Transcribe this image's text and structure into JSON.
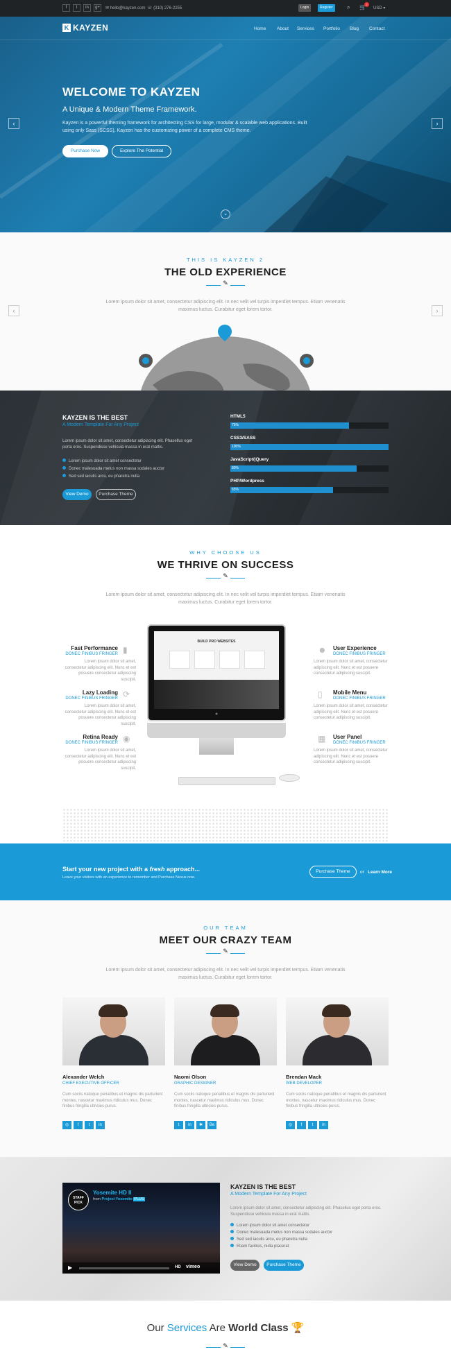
{
  "topbar": {
    "social_icons": [
      "facebook-icon",
      "twitter-icon",
      "linkedin-icon",
      "google-plus-icon"
    ],
    "social_glyphs": [
      "f",
      "t",
      "in",
      "g+"
    ],
    "email": "hello@kayzen.com",
    "phone": "(310) 276-2255",
    "login_label": "Login",
    "register_label": "Register",
    "currency": "USD",
    "cart_count": "2"
  },
  "header": {
    "logo_text": "KAYZEN",
    "nav": [
      "Home",
      "About",
      "Services",
      "Portfolio",
      "Blog",
      "Contact"
    ]
  },
  "hero": {
    "title": "WELCOME TO KAYZEN",
    "subtitle": "A Unique & Modern Theme Framework.",
    "body": "Kayzen is a powerful theming framework for architecting CSS for large, modular & scalable web applications. Built using only Sass (SCSS), Kayzen has the customizing power of a complete CMS theme.",
    "btn_primary": "Purchase Now",
    "btn_secondary": "Explore The Potential",
    "prev_glyph": "‹",
    "next_glyph": "›",
    "scroll_glyph": "⌄"
  },
  "old_experience": {
    "kicker": "THIS IS KAYZEN 2",
    "title": "THE OLD EXPERIENCE",
    "lead": "Lorem ipsum dolor sit amet, consectetur adipiscing elit. In nec velit vel turpis imperdiet tempus. Etiam venenatis maximus luctus. Curabitur eget lorem tortor."
  },
  "best": {
    "title": "KAYZEN IS THE BEST",
    "subtitle": "A Modern Template For Any Project",
    "body": "Lorem ipsum dolor sit amet, consectetur adipiscing elit. Phasellus eget porta eros. Suspendisse vehicula massa in erat mattis.",
    "list": [
      "Lorem ipsum dolor sit amet consectetur",
      "Donec malesuada metus non massa sodales auctor",
      "Sed sed iaculis arcu, eu pharetra nulla"
    ],
    "btn1": "View Demo",
    "btn2": "Purchase Theme",
    "skills": [
      {
        "label": "HTML5",
        "pct": "75%",
        "value": 0.75
      },
      {
        "label": "CSS3/SASS",
        "pct": "100%",
        "value": 1.0
      },
      {
        "label": "JavaScript/jQuery",
        "pct": "80%",
        "value": 0.8
      },
      {
        "label": "PHP/Wordpress",
        "pct": "65%",
        "value": 0.65
      }
    ]
  },
  "why": {
    "kicker": "WHY CHOOSE US",
    "title": "WE THRIVE ON SUCCESS",
    "lead": "Lorem ipsum dolor sit amet, consectetur adipiscing elit. In nec velit vel turpis imperdiet tempus. Etiam venenatis maximus luctus. Curabitur eget lorem tortor.",
    "features_left": [
      {
        "title": "Fast Performance",
        "sub": "DONEC FINIBUS FRINGER",
        "text": "Lorem ipsum dolor sit amet, consectetur adipiscing elit. Nunc et est posuere consectetur adipiscing suscipit.",
        "icon": "bar-chart-icon",
        "glyph": "▮"
      },
      {
        "title": "Lazy Loading",
        "sub": "DONEC FINIBUS FRINGER",
        "text": "Lorem ipsum dolor sit amet, consectetur adipiscing elit. Nunc et est posuere consectetur adipiscing suscipit.",
        "icon": "refresh-icon",
        "glyph": "⟳"
      },
      {
        "title": "Retina Ready",
        "sub": "DONEC FINIBUS FRINGER",
        "text": "Lorem ipsum dolor sit amet, consectetur adipiscing elit. Nunc et est posuere consectetur adipiscing suscipit.",
        "icon": "eye-icon",
        "glyph": "◉"
      }
    ],
    "features_right": [
      {
        "title": "User Experience",
        "sub": "DONEC FINIBUS FRINGER",
        "text": "Lorem ipsum dolor sit amet, consectetur adipiscing elit. Nunc et est posuere consectetur adipiscing suscipit.",
        "icon": "user-icon",
        "glyph": "☻"
      },
      {
        "title": "Mobile Menu",
        "sub": "DONEC FINIBUS FRINGER",
        "text": "Lorem ipsum dolor sit amet, consectetur adipiscing elit. Nunc et est posuere consectetur adipiscing suscipit.",
        "icon": "mobile-icon",
        "glyph": "▯"
      },
      {
        "title": "User Panel",
        "sub": "DONEC FINIBUS FRINGER",
        "text": "Lorem ipsum dolor sit amet, consectetur adipiscing elit. Nunc et est posuere consectetur adipiscing suscipit.",
        "icon": "grid-icon",
        "glyph": "▦"
      }
    ],
    "screen_heading": "BUILD PRO WEBSITES"
  },
  "cta": {
    "title_pre": "Start your new project with a ",
    "title_em": "fresh",
    "title_post": " approach...",
    "sub": "Leave your visitors with an experience to remember and Purchase Nexus now.",
    "btn": "Purchase Theme",
    "or": "or",
    "learn": "Learn More"
  },
  "team": {
    "kicker": "OUR TEAM",
    "title": "MEET OUR CRAZY TEAM",
    "lead": "Lorem ipsum dolor sit amet, consectetur adipiscing elit. In nec velit vel turpis imperdiet tempus. Etiam venenatis maximus luctus. Curabitur eget lorem tortor.",
    "members": [
      {
        "name": "Alexander Welch",
        "role": "CHIEF EXECUTIVE OFFICER",
        "text": "Cum sociis natoque penatibus et magnis dis parturient montes, nascetur maximus ridiculus mus. Donec finibus fringilla ultricies purus.",
        "social": [
          "◎",
          "f",
          "t",
          "in"
        ]
      },
      {
        "name": "Naomi Olson",
        "role": "GRAPHIC DESIGNER",
        "text": "Cum sociis natoque penatibus et magnis dis parturient montes, nascetur maximus ridiculus mus. Donec finibus fringilla ultricies purus.",
        "social": [
          "t",
          "in",
          "✱",
          "Be"
        ]
      },
      {
        "name": "Brendan Mack",
        "role": "WEB DEVELOPER",
        "text": "Cum sociis natoque penatibus et magnis dis parturient montes, nascetur maximus ridiculus mus. Donec finibus fringilla ultricies purus.",
        "social": [
          "◎",
          "f",
          "t",
          "in"
        ]
      }
    ]
  },
  "video": {
    "badge": "STAFF PICK",
    "title": "Yosemite HD II",
    "by_pre": "from",
    "by": "Project Yosemite",
    "plus": "PLUS",
    "hd": "HD",
    "vimeo": "vimeo",
    "side_title": "KAYZEN IS THE BEST",
    "side_sub": "A Modern Template For Any Project",
    "side_body": "Lorem ipsum dolor sit amet, consectetur adipiscing elit. Phasellus eget porta eros. Suspendisse vehicula massa in erat mattis.",
    "list": [
      "Lorem ipsum dolor sit amet consectetur",
      "Donec malesuada metus non massa sodales auctor",
      "Sed sed iaculis arcu, eu pharetra nulla",
      "Etiam facilisis, nulla placerat"
    ],
    "btn1": "View Demo",
    "btn2": "Purchase Theme"
  },
  "services": {
    "pre": "Our ",
    "accent": "Services",
    "mid": " Are ",
    "bold": "World Class",
    "trophy": "🏆"
  }
}
